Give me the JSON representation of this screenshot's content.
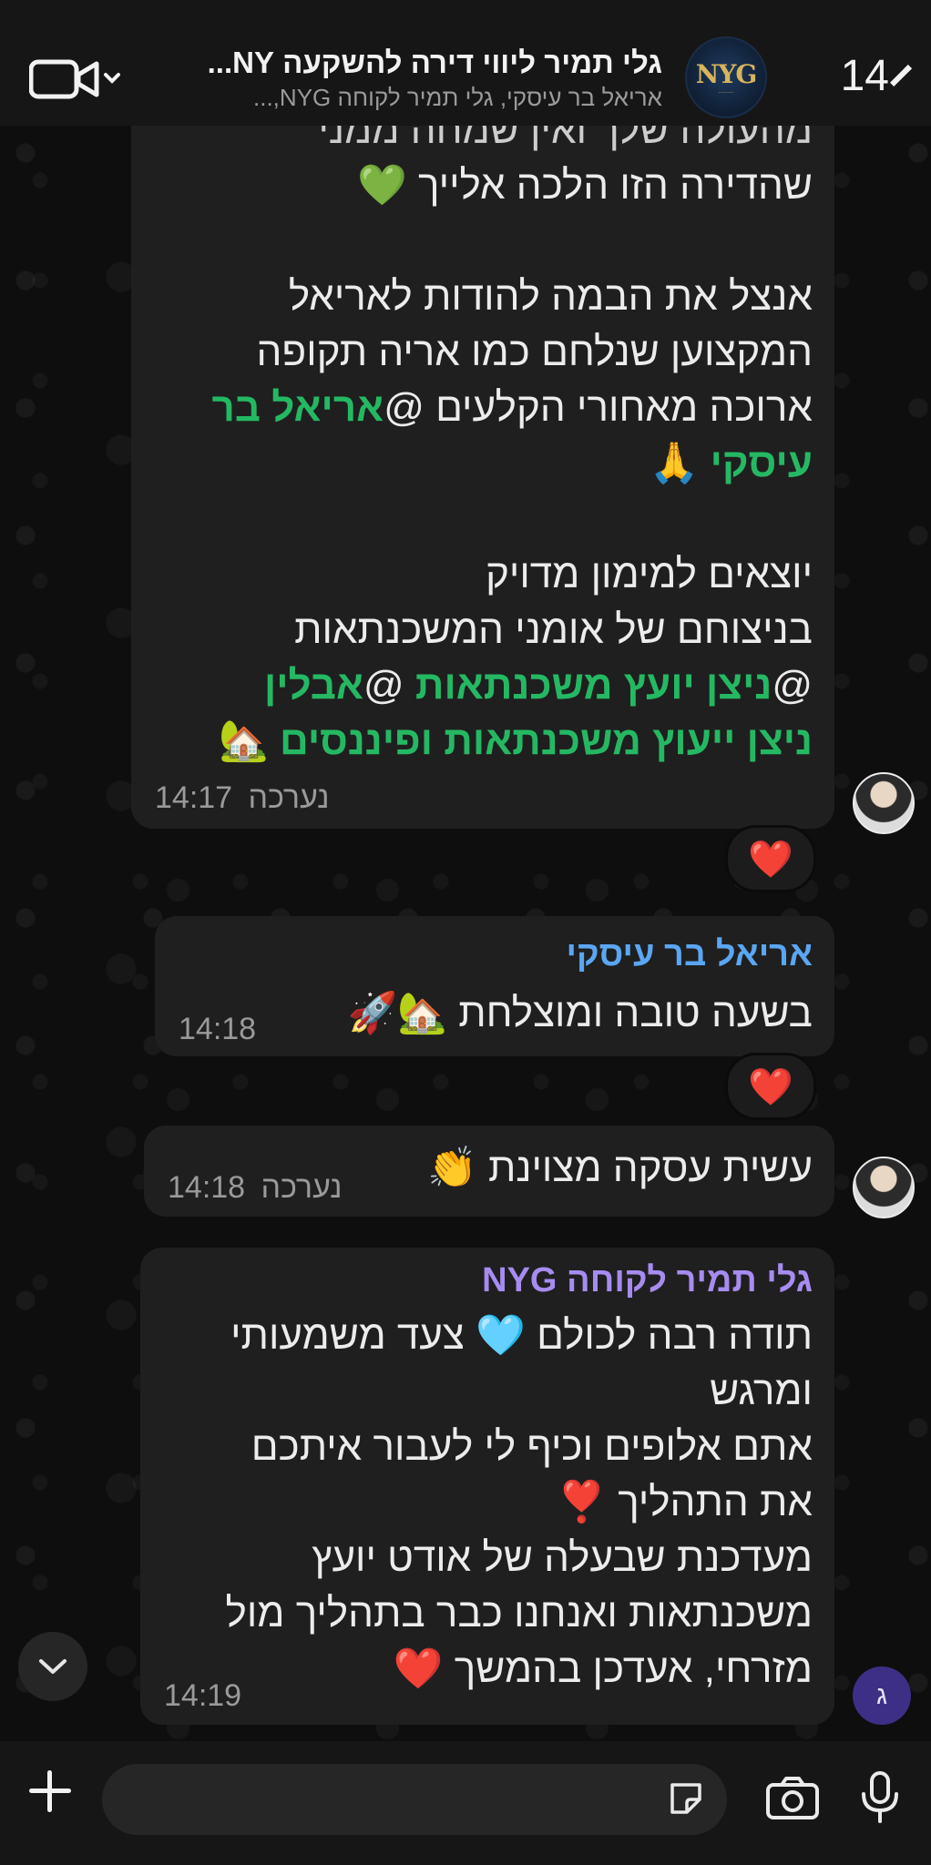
{
  "header": {
    "back_count": "14",
    "title": "גלי תמיר ליווי דירה להשקעה NY...",
    "subtitle": "אריאל בר עיסקי, גלי תמיר לקוחה NYG,..."
  },
  "messages": {
    "m1": {
      "lines": [
        "מהעולה שלך ואין שמחה ממני",
        "שהדירה הזו הלכה אלייך 💚",
        "",
        "אנצל את הבמה להודות לאריאל",
        "המקצוען שנלחם כמו אריה תקופה",
        "ארוכה מאחורי הקלעים @"
      ],
      "mention1": "אריאל בר",
      "mention1b": "עיסקי",
      "after_mention1b": " 🙏",
      "lines2": [
        "",
        "יוצאים למימון מדויק",
        "בניצוחם של אומני המשכנתאות"
      ],
      "at": "@",
      "mention2": "ניצן יועץ משכנתאות",
      "at2": " @",
      "mention3": "אבלין",
      "mention4": "ניצן ייעוץ משכנתאות ופיננסים",
      "tail_emoji": " 🏡",
      "edited": "נערכה",
      "time": "14:17",
      "reaction": "❤️"
    },
    "m2": {
      "sender": "אריאל בר עיסקי",
      "text": "בשעה טובה ומוצלחת 🏡🚀",
      "time": "14:18",
      "reaction": "❤️"
    },
    "m3": {
      "text": "עשית עסקה מצוינת 👏",
      "edited": "נערכה",
      "time": "14:18"
    },
    "m4": {
      "sender": "גלי תמיר לקוחה NYG",
      "lines": [
        "תודה רבה לכולם 🩵 צעד משמעותי",
        "ומרגש",
        "אתם אלופים וכיף לי לעבור איתכם",
        "את התהליך ❣️",
        "מעדכנת שבעלה של אודט יועץ",
        "משכנתאות ואנחנו כבר בתהליך מול",
        "מזרחי, אעדכן בהמשך ❤️"
      ],
      "time": "14:19",
      "avatar_letter": "ג"
    }
  },
  "icons": {
    "video": "video-call-icon",
    "scroll": "chevron-down-icon",
    "plus": "plus-icon",
    "sticker": "sticker-icon",
    "camera": "camera-icon",
    "mic": "microphone-icon"
  },
  "colors": {
    "mention": "#25b863",
    "sender_ariel": "#5aa6f2",
    "sender_gali": "#a68cf0",
    "bubble": "#1f1f1f",
    "heart": "#e41b3c"
  }
}
